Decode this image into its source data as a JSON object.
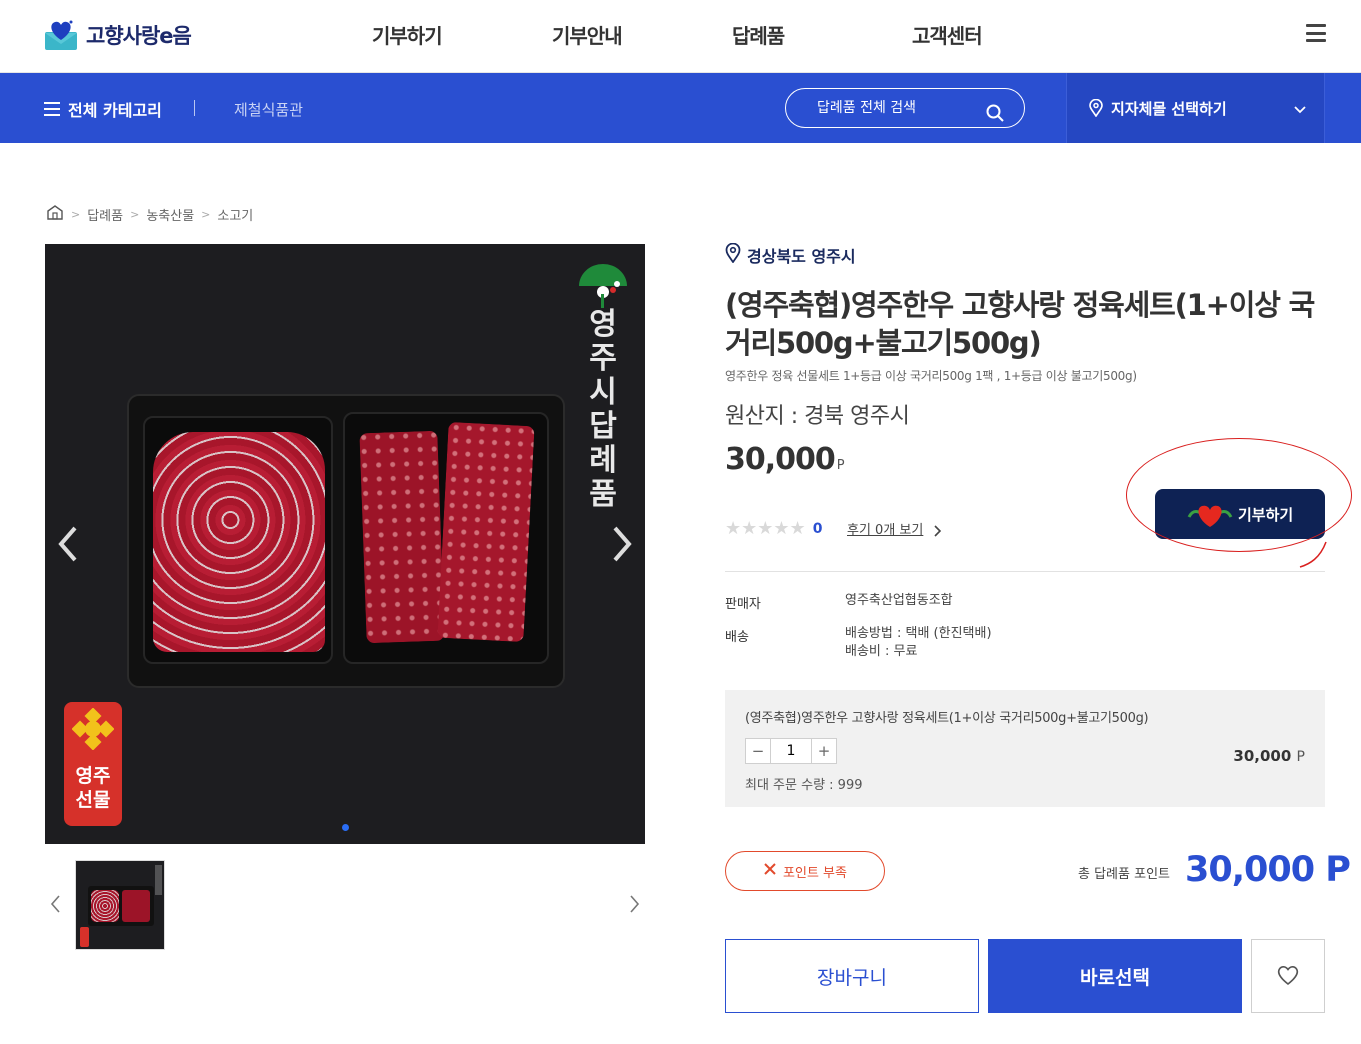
{
  "header": {
    "logo_text": "고향사랑e음",
    "nav": [
      "기부하기",
      "기부안내",
      "답례품",
      "고객센터"
    ]
  },
  "subbar": {
    "all_categories": "전체 카테고리",
    "shop_name": "제철식품관",
    "search_placeholder": "답례품 전체 검색",
    "region_select": "지자체몰 선택하기"
  },
  "breadcrumb": [
    "답례품",
    "농축산물",
    "소고기"
  ],
  "image": {
    "vertical_text": "영주시답례품",
    "badge_text": "영주선물",
    "slide_count": 1,
    "thumbnail_count": 1
  },
  "product": {
    "region": "경상북도 영주시",
    "title": "(영주축협)영주한우 고향사랑 정육세트(1+이상 국거리500g+불고기500g)",
    "description": "영주한우 정육 선물세트 1+등급 이상 국거리500g 1팩 , 1+등급 이상 불고기500g)",
    "origin": "원산지 : 경북 영주시",
    "price": "30,000",
    "price_unit": "P",
    "rating_stars": "★★★★★",
    "rating_count": "0",
    "review_link": "후기 0개 보기",
    "donate_button": "기부하기"
  },
  "info": {
    "seller_label": "판매자",
    "seller_value": "영주축산업협동조합",
    "delivery_label": "배송",
    "delivery_method": "배송방법 : 택배 (한진택배)",
    "delivery_fee": "배송비 : 무료"
  },
  "option": {
    "name": "(영주축협)영주한우 고향사랑 정육세트(1+이상 국거리500g+불고기500g)",
    "minus": "−",
    "plus": "+",
    "quantity": "1",
    "price": "30,000",
    "price_unit": "P",
    "max_order": "최대 주문 수량 : 999"
  },
  "points": {
    "status_badge": "포인트 부족",
    "total_label": "총 답례품 포인트",
    "total_value": "30,000 P"
  },
  "actions": {
    "cart": "장바구니",
    "buy": "바로선택"
  },
  "colors": {
    "primary": "#2a4fd1",
    "navy": "#0e2254",
    "alert": "#e24a2c",
    "annotation": "#d9201f"
  }
}
